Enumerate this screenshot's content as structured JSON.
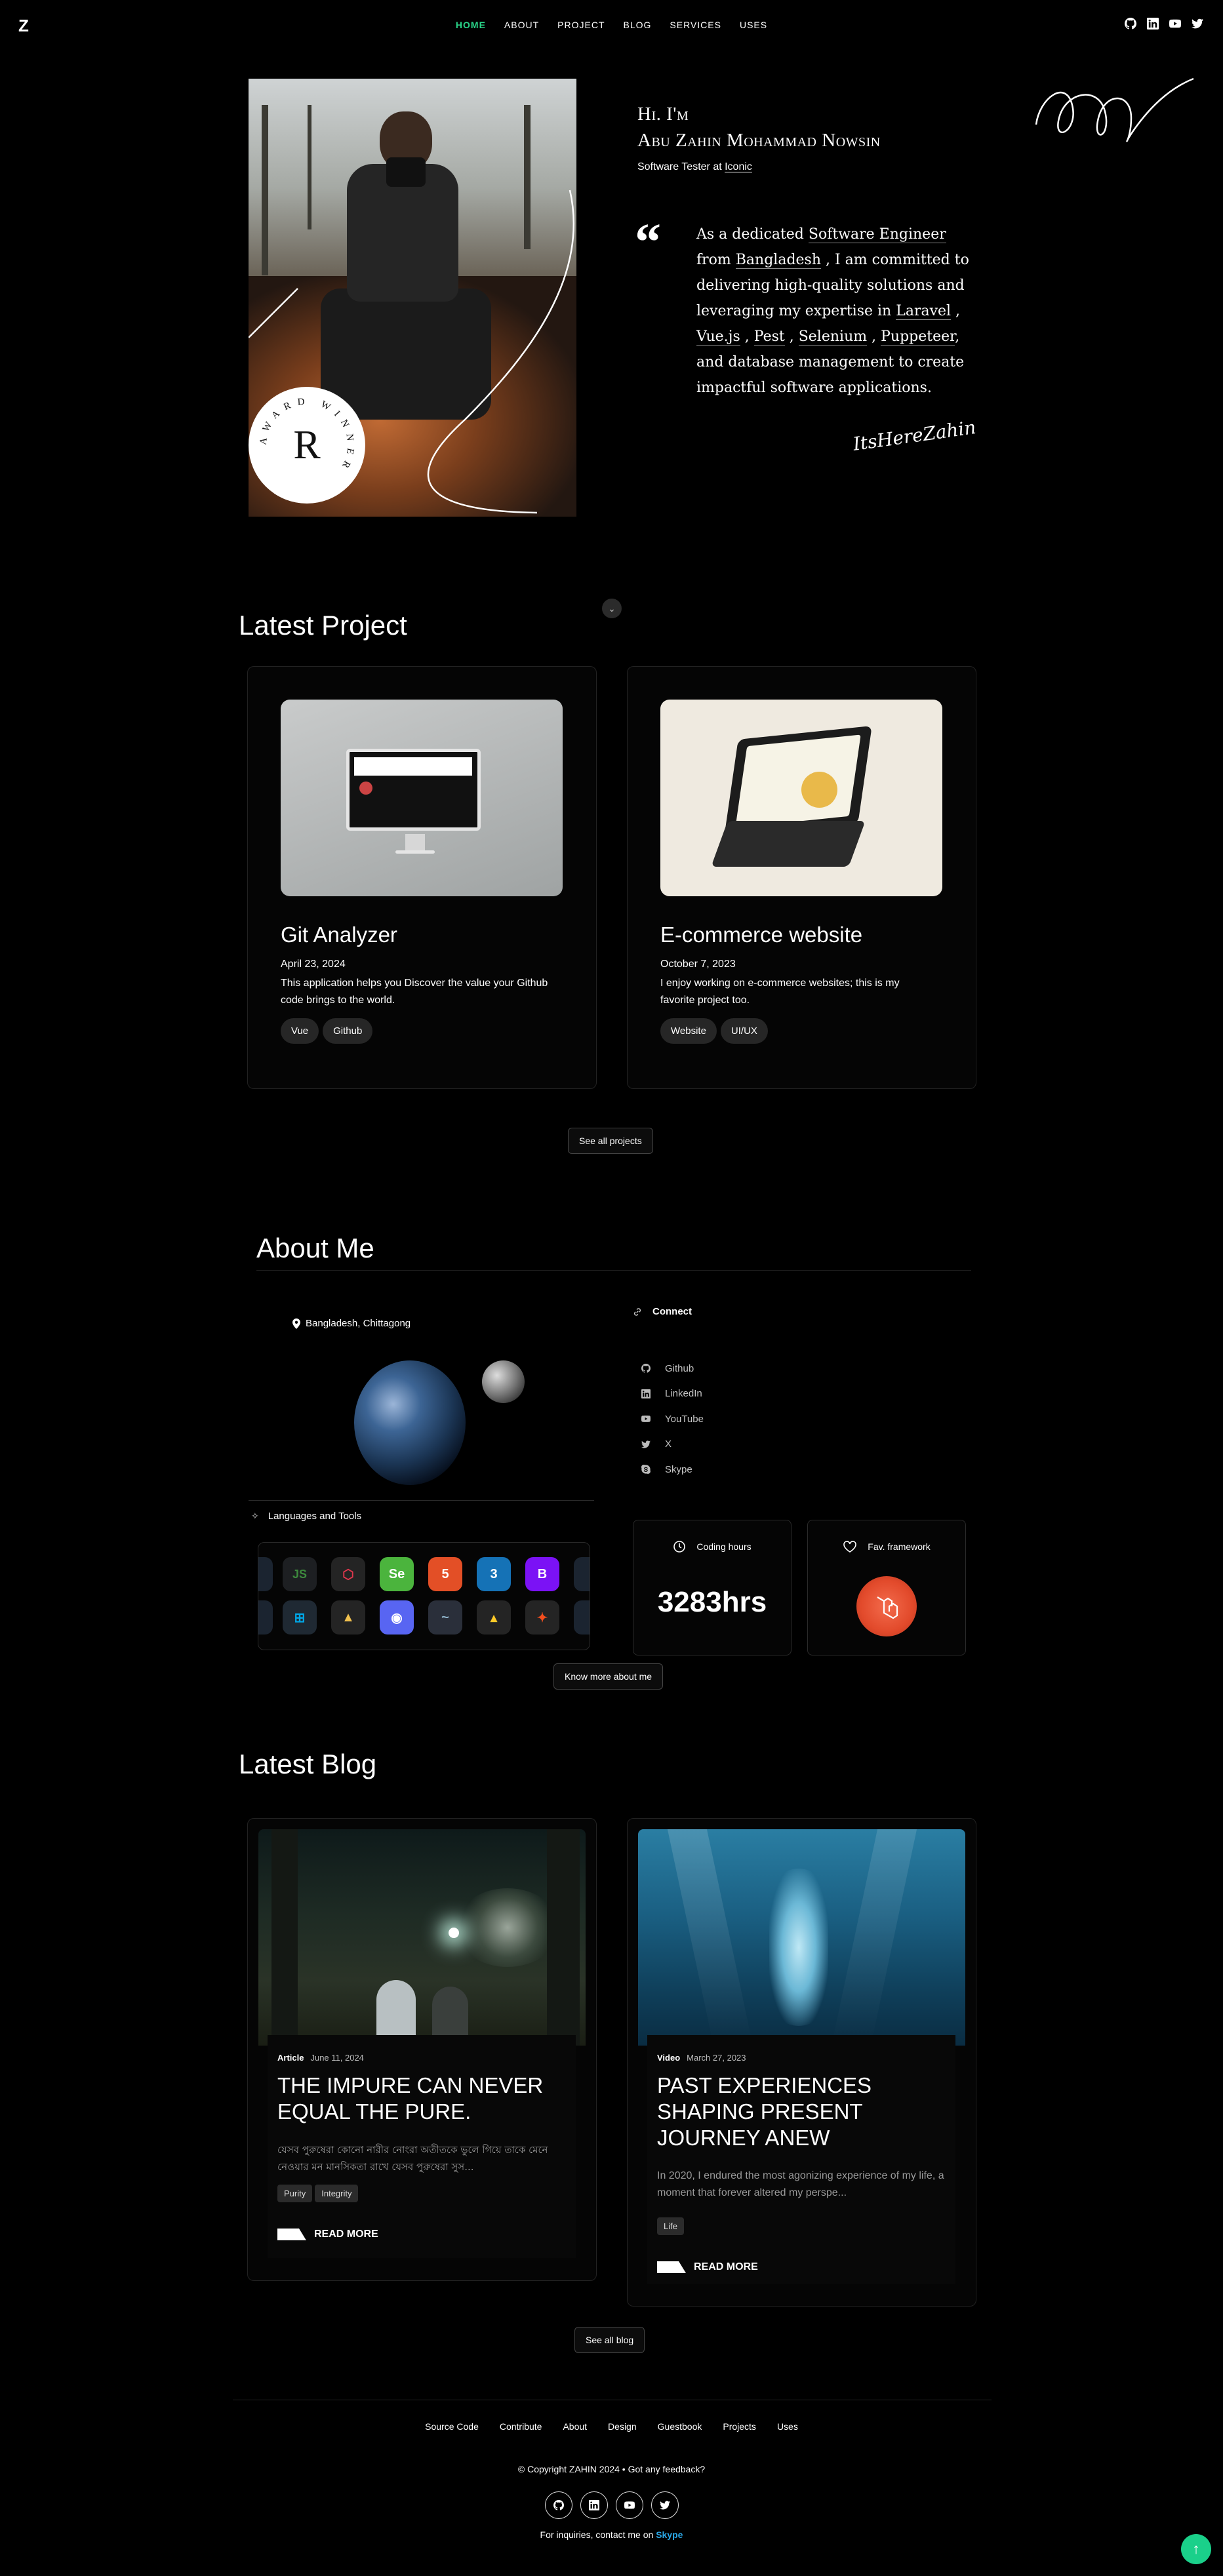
{
  "nav": {
    "logo": "Z",
    "items": [
      "HOME",
      "ABOUT",
      "PROJECT",
      "BLOG",
      "SERVICES",
      "USES"
    ],
    "active": "HOME",
    "social_icons": [
      "github-icon",
      "linkedin-icon",
      "youtube-icon",
      "twitter-icon"
    ]
  },
  "hero": {
    "greeting_line1": "Hi. I'm",
    "greeting_line2": "Abu Zahin Mohammad Nowsin",
    "role_prefix": "Software Tester at",
    "role_company": "Iconic",
    "award_letter": "R",
    "award_ring": "AWARD WINNER",
    "quote_mark": "“",
    "bio": {
      "p1": "As a dedicated",
      "role": "Software Engineer",
      "p2": "from",
      "country": "Bangladesh",
      "p3": ", I am committed to delivering high-quality solutions and leveraging my expertise in",
      "t1": "Laravel",
      "t2": "Vue.js",
      "t3": "Pest",
      "t4": "Selenium",
      "t5": "Puppeteer",
      "p4": ", and database management to create impactful software applications."
    },
    "signature": "ItsHereZahin"
  },
  "projects": {
    "title": "Latest Project",
    "items": [
      {
        "title": "Git Analyzer",
        "date": "April 23, 2024",
        "description": "This application helps you Discover the value your Github code brings to the world.",
        "tags": [
          "Vue",
          "Github"
        ]
      },
      {
        "title": "E-commerce website",
        "date": "October 7, 2023",
        "description": "I enjoy working on e-commerce websites; this is my favorite project too.",
        "tags": [
          "Website",
          "UI/UX"
        ]
      }
    ],
    "see_all": "See all projects"
  },
  "about": {
    "title": "About Me",
    "location": "Bangladesh, Chittagong",
    "connect_title": "Connect",
    "connect_links": [
      {
        "label": "Github",
        "icon": "github-icon"
      },
      {
        "label": "LinkedIn",
        "icon": "linkedin-icon"
      },
      {
        "label": "YouTube",
        "icon": "youtube-icon"
      },
      {
        "label": "X",
        "icon": "twitter-icon"
      },
      {
        "label": "Skype",
        "icon": "skype-icon"
      }
    ],
    "languages_title": "Languages and Tools",
    "tools_row1": [
      "nodejs-icon",
      "laravel-icon",
      "selenium-icon",
      "html5-icon",
      "css3-icon",
      "bootstrap-icon"
    ],
    "tools_row2": [
      "windows-icon",
      "linux-icon",
      "discord-icon",
      "mysql-icon",
      "firebase-icon",
      "figma-icon"
    ],
    "coding_hours_label": "Coding hours",
    "coding_hours_value": "3283hrs",
    "framework_label": "Fav. framework",
    "framework_icon": "laravel-icon",
    "know_more": "Know more about me"
  },
  "blog": {
    "title": "Latest Blog",
    "posts": [
      {
        "type": "Article",
        "date": "June 11, 2024",
        "title": "THE IMPURE CAN NEVER EQUAL THE PURE.",
        "excerpt": "যেসব পুরুষেরা কোনো নারীর নোংরা অতীতকে ভুলে গিয়ে তাকে মেনে নেওয়ার মন মানসিকতা রাখে যেসব পুরুষেরা সুস...",
        "tags": [
          "Purity",
          "Integrity"
        ],
        "read_more": "READ MORE"
      },
      {
        "type": "Video",
        "date": "March 27, 2023",
        "title": "PAST EXPERIENCES SHAPING PRESENT JOURNEY ANEW",
        "excerpt": "In 2020, I endured the most agonizing experience of my life, a moment that forever altered my perspe...",
        "tags": [
          "Life"
        ],
        "read_more": "READ MORE"
      }
    ],
    "see_all": "See all blog"
  },
  "footer": {
    "links": [
      "Source Code",
      "Contribute",
      "About",
      "Design",
      "Guestbook",
      "Projects",
      "Uses"
    ],
    "copyright": "© Copyright ZAHIN 2024 • Got any feedback?",
    "inquiry_prefix": "For inquiries, contact me on",
    "inquiry_link": "Skype",
    "social_icons": [
      "github-icon",
      "linkedin-icon",
      "youtube-icon",
      "twitter-icon"
    ]
  },
  "colors": {
    "accent": "#2ad68a",
    "background": "#000000",
    "link": "#2aa7e6"
  }
}
